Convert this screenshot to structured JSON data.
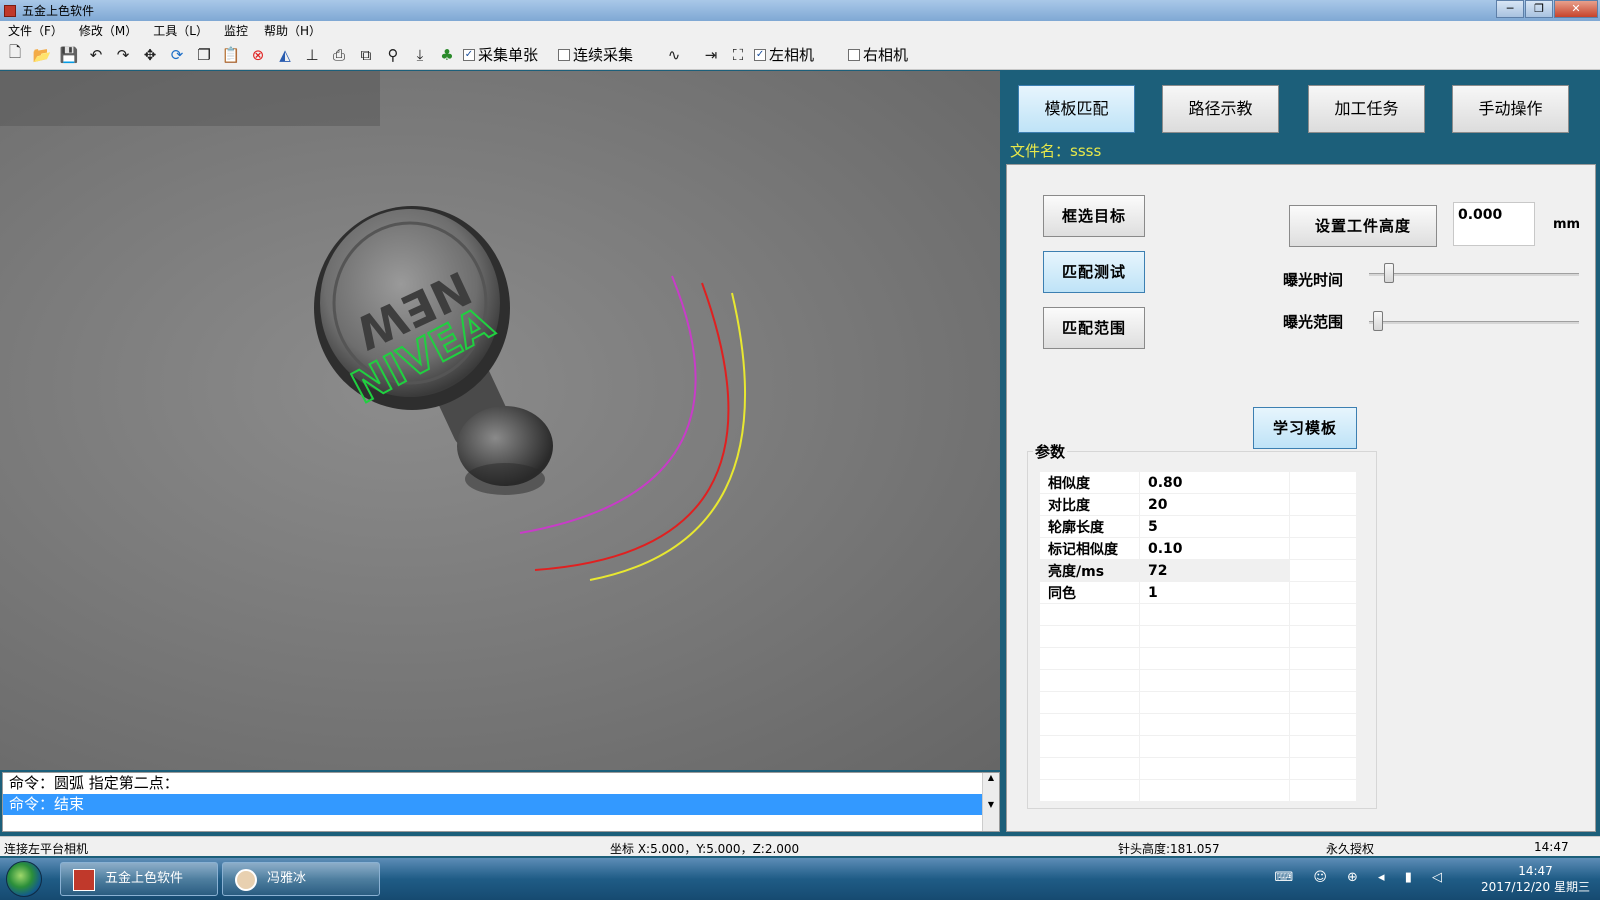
{
  "window": {
    "title": "五金上色软件",
    "controls": [
      "─",
      "❐",
      "✕"
    ]
  },
  "menu": [
    "文件（F）",
    "修改（M）",
    "工具（L）",
    "监控",
    "帮助（H）"
  ],
  "toolbar": {
    "icons": [
      "new-icon",
      "open-icon",
      "save-icon",
      "undo-icon",
      "redo-icon",
      "move-icon",
      "refresh-icon",
      "copy-icon",
      "paste-icon",
      "delete-icon",
      "mirror-icon",
      "stamp-icon",
      "print-icon",
      "crop-icon",
      "pin-icon",
      "arrow-down-icon",
      "tree-icon"
    ],
    "checks": [
      {
        "label": "采集单张",
        "checked": true
      },
      {
        "label": "连续采集",
        "checked": false
      }
    ],
    "checks2": [
      {
        "label": "左相机",
        "checked": true
      },
      {
        "label": "右相机",
        "checked": false
      }
    ]
  },
  "camera": {
    "coin_text": "NEW",
    "overlay_text": "NIVEA"
  },
  "command": {
    "lines": [
      "命令：圆弧 指定第二点：",
      "命令：结束"
    ]
  },
  "tabs": [
    "模板匹配",
    "路径示教",
    "加工任务",
    "手动操作"
  ],
  "filename": "文件名：ssss",
  "panel": {
    "btn_select_target": "框选目标",
    "btn_match_test": "匹配测试",
    "btn_match_range": "匹配范围",
    "btn_set_height": "设置工件高度",
    "height_value": "0.000",
    "height_unit": "mm",
    "exposure_time_label": "曝光时间",
    "exposure_range_label": "曝光范围",
    "exposure_time_level": 0.07,
    "exposure_range_level": 0.02,
    "btn_learn_template": "学习模板",
    "params_title": "参数",
    "params": [
      {
        "name": "相似度",
        "value": "0.80"
      },
      {
        "name": "对比度",
        "value": "20"
      },
      {
        "name": "轮廓长度",
        "value": "5"
      },
      {
        "name": "标记相似度",
        "value": "0.10"
      },
      {
        "name": "亮度/ms",
        "value": "72"
      },
      {
        "name": "同色",
        "value": "1"
      }
    ]
  },
  "status": {
    "camera": "连接左平台相机",
    "coords": "坐标 X:5.000，Y:5.000，Z:2.000",
    "needle": "针头高度:181.057",
    "license": "永久授权",
    "time": "14:47"
  },
  "taskbar": {
    "tasks": [
      "五金上色软件",
      "冯雅冰"
    ],
    "clock_time": "14:47",
    "clock_date": "2017/12/20 星期三"
  },
  "colors": {
    "accent": "#3399ff",
    "panel_bg": "#1c5f7a",
    "filename": "#e8e84a",
    "arc_magenta": "#c83cc8",
    "arc_red": "#e02020",
    "arc_yellow": "#e8e830",
    "match_green": "#20d040"
  }
}
